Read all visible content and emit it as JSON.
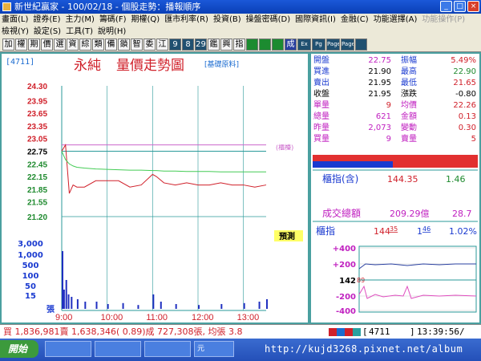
{
  "window": {
    "title": "新世紀贏家 - 100/02/18 - 個股走勢：播報順序",
    "controls": [
      "_",
      "□",
      "×"
    ]
  },
  "menu": {
    "row1": [
      "畫面(L)",
      "證券(E)",
      "主力(M)",
      "籌碼(F)",
      "期權(Q)",
      "匯市利率(R)",
      "投資(B)",
      "操盤密碼(D)",
      "國際資訊(I)",
      "金融(C)",
      "功能選擇(A)",
      "功能操作(P)"
    ],
    "row2": [
      "檢視(Y)",
      "設定(S)",
      "工具(T)",
      "說明(H)"
    ]
  },
  "toolbar": {
    "buttons": [
      "加",
      "權",
      "期",
      "價",
      "選",
      "資",
      "綜",
      "類",
      "備",
      "鎖",
      "智",
      "委",
      "江",
      "9",
      "8",
      "29",
      "鑑",
      "興",
      "指",
      "",
      "",
      "",
      "成",
      "Ex",
      "Pg",
      "Page",
      "Page",
      ""
    ]
  },
  "stock": {
    "code": "[4711]",
    "name": "永純",
    "chart_title": "量價走勢圖",
    "sector": "[基礎原料]"
  },
  "price_axis": {
    "ticks": [
      "24.30",
      "23.95",
      "23.65",
      "23.35",
      "23.05",
      "22.75",
      "22.45",
      "22.15",
      "21.85",
      "21.55",
      "21.20"
    ],
    "ref_label": "(櫃檯)"
  },
  "volume_axis": {
    "ticks": [
      "3,000",
      "1,000",
      "500",
      "100",
      "50",
      "15"
    ],
    "unit": "張"
  },
  "time_axis": {
    "ticks": [
      "9:00",
      "10:00",
      "11:00",
      "12:00",
      "13:00"
    ]
  },
  "flash_label": "預測",
  "quote": {
    "rows": [
      {
        "l1": "開盤",
        "v1": "22.75",
        "l2": "振幅",
        "v2": "5.49%"
      },
      {
        "l1": "買進",
        "v1": "21.90",
        "l2": "最高",
        "v2": "22.90"
      },
      {
        "l1": "賣出",
        "v1": "21.95",
        "l2": "最低",
        "v2": "21.65"
      },
      {
        "l1": "收盤",
        "v1": "21.95",
        "l2": "漲跌",
        "v2": "-0.80"
      },
      {
        "l1": "單量",
        "v1": "9",
        "l2": "均價",
        "v2": "22.26"
      },
      {
        "l1": "總量",
        "v1": "621",
        "l2": "金額",
        "v2": "0.13"
      },
      {
        "l1": "昨量",
        "v1": "2,073",
        "l2": "變動",
        "v2": "0.30"
      },
      {
        "l1": "買量",
        "v1": "9",
        "l2": "賣量",
        "v2": "5"
      }
    ]
  },
  "otc_index": {
    "label": "櫃指(含)",
    "value": "144.35",
    "change": "1.46",
    "turnover_label": "成交總額",
    "turnover_value": "209.29億",
    "turnover_change": "28.7"
  },
  "mini_chart": {
    "title": "櫃指",
    "value_main": "144",
    "value_frac": "35",
    "change_main": "1",
    "change_frac": "46",
    "pct": "1.02%",
    "ticks": [
      "+400",
      "+200",
      "142",
      "-200",
      "-400"
    ],
    "center_frac": "89"
  },
  "status": {
    "text": "買 1,836,981賣 1,638,346( 0.89)成 727,308張, 均張 3.8",
    "code": "4711",
    "time": "13:39:56/"
  },
  "taskbar": {
    "start": "開始",
    "items": [
      "",
      "",
      "",
      "元"
    ],
    "url": "http://kujd3268.pixnet.net/album"
  },
  "colors": {
    "up": "#d0202a",
    "down": "#1e8a2e",
    "price_line": "#d0202a",
    "avg_line": "#44cc55",
    "ref_line": "#2a9a9a",
    "high_line": "#cc66cc",
    "volume": "#2030c0"
  },
  "chart_data": [
    {
      "type": "line",
      "title": "量價走勢圖",
      "x": [
        "9:00",
        "9:05",
        "9:10",
        "9:15",
        "9:20",
        "9:30",
        "9:45",
        "10:00",
        "10:15",
        "10:30",
        "10:45",
        "11:00",
        "11:05",
        "11:15",
        "11:30",
        "11:45",
        "12:00",
        "12:15",
        "12:30",
        "12:45",
        "13:00",
        "13:15",
        "13:30"
      ],
      "series": [
        {
          "name": "price",
          "values": [
            22.75,
            22.9,
            21.75,
            21.95,
            21.9,
            21.9,
            22.05,
            22.05,
            22.05,
            21.9,
            21.95,
            22.2,
            22.15,
            22.0,
            21.95,
            22.0,
            21.95,
            21.95,
            22.0,
            21.95,
            21.95,
            21.9,
            21.95
          ]
        },
        {
          "name": "average",
          "values": [
            22.75,
            22.55,
            22.45,
            22.4,
            22.37,
            22.35,
            22.33,
            22.32,
            22.31,
            22.3,
            22.3,
            22.29,
            22.29,
            22.28,
            22.28,
            22.27,
            22.27,
            22.27,
            22.26,
            22.26,
            22.26,
            22.26,
            22.26
          ]
        }
      ],
      "reference": 22.75,
      "ylim": [
        21.2,
        24.3
      ]
    },
    {
      "type": "bar",
      "title": "volume",
      "x": [
        "9:00",
        "9:02",
        "9:05",
        "9:08",
        "9:12",
        "9:20",
        "9:30",
        "9:45",
        "10:00",
        "10:20",
        "10:40",
        "11:00",
        "11:10",
        "11:30",
        "12:00",
        "12:30",
        "13:00",
        "13:20",
        "13:30"
      ],
      "values": [
        120,
        40,
        60,
        30,
        25,
        20,
        15,
        15,
        10,
        12,
        8,
        30,
        15,
        10,
        8,
        10,
        12,
        15,
        20
      ]
    },
    {
      "type": "line",
      "title": "櫃指",
      "x": [
        "9:00",
        "10:00",
        "11:00",
        "12:00",
        "13:00",
        "13:30"
      ],
      "series": [
        {
          "name": "index",
          "values": [
            142.89,
            144.2,
            144.3,
            144.3,
            144.35,
            144.35
          ]
        }
      ],
      "ylim": [
        -400,
        400
      ]
    }
  ]
}
